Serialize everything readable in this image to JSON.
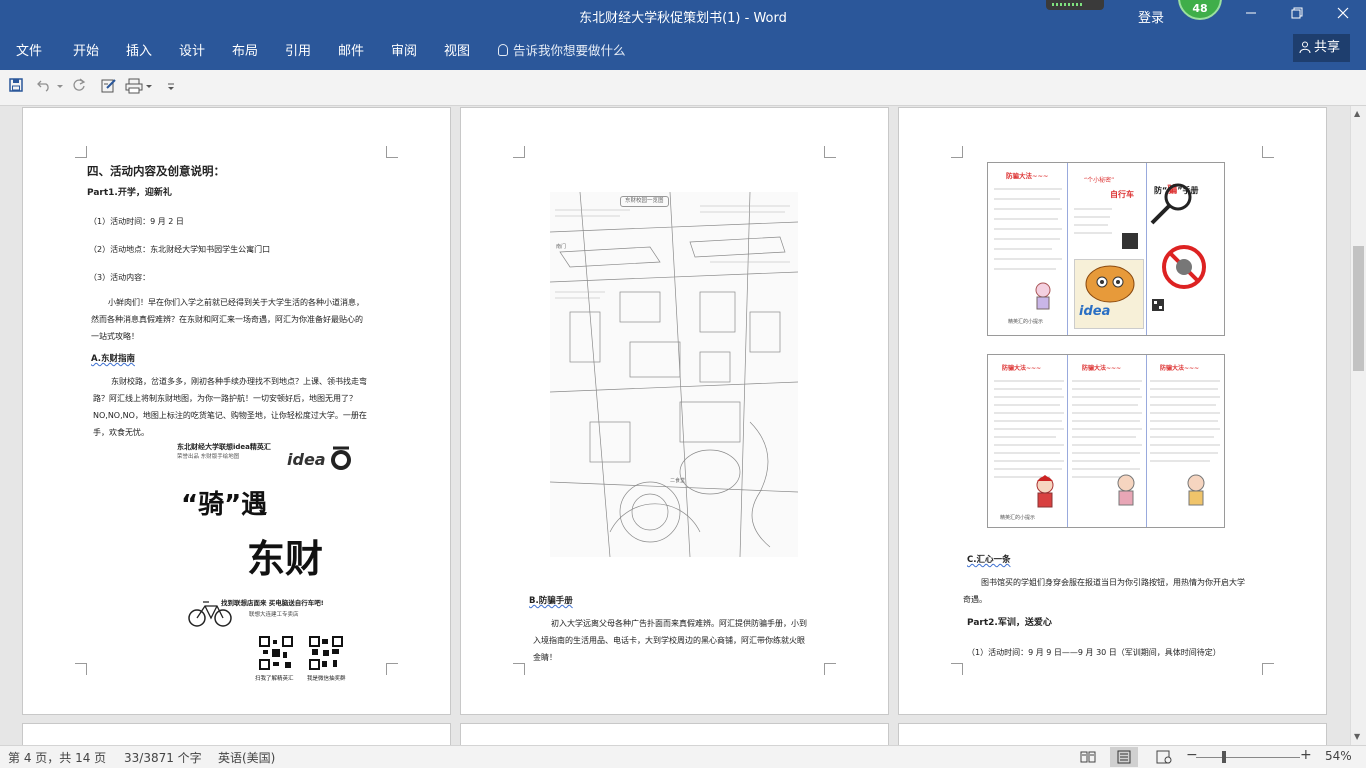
{
  "window": {
    "title": "东北财经大学秋促策划书(1)  -  Word",
    "login_label": "登录",
    "notification_count": "48"
  },
  "ribbon": {
    "tabs": [
      "文件",
      "开始",
      "插入",
      "设计",
      "布局",
      "引用",
      "邮件",
      "审阅",
      "视图"
    ],
    "tell_me_placeholder": "告诉我你想要做什么",
    "share_label": "共享"
  },
  "page1": {
    "heading": "四、活动内容及创意说明：",
    "part1": "Part1.开学，迎新礼",
    "item1": "（1）活动时间：9 月 2 日",
    "item2": "（2）活动地点：东北财经大学知书园学生公寓门口",
    "item3": "（3）活动内容：",
    "para1_l1": "小鲜肉们！早在你们入学之前就已经得到关于大学生活的各种小道消息，",
    "para1_l2": "然而各种消息真假难辨？在东财和阿汇来一场奇遇，阿汇为你准备好最贴心的",
    "para1_l3": "一站式攻略！",
    "sectionA": "A.东财指南",
    "para2_l1": "东财校路，岔道多多，刚初各种手续办理找不到地点？上课、领书找走弯",
    "para2_l2": "路？阿汇线上将制东财地图，为你一路护航！一切安顿好后，地图无用了？",
    "para2_l3": "NO,NO,NO，地图上标注的吃货笔记、购物圣地，让你轻松度过大学。一册在",
    "para2_l4": "手，欢食无忧。",
    "poster_top": "东北财经大学联想idea精英汇",
    "poster_sub": "荣誉出品 东财版手绘地图",
    "poster_brand": "idea",
    "poster_ride": "“骑”遇",
    "poster_campus": "东财",
    "poster_bike": "找到联想店面来 买电脑送自行车吧!",
    "poster_store": "联想大连建工专卖店",
    "qr_left": "扫我了解精英汇",
    "qr_right": "我是微信抽奖群"
  },
  "page2": {
    "map_title": "东财校园一览图",
    "map_label_left": "南门",
    "map_label_bottom": "二食堂",
    "sectionB": "B.防骗手册",
    "para_l1": "初入大学远离父母各种广告扑面而来真假难辨。阿汇提供防骗手册，小到",
    "para_l2": "入境指南的生活用品、电话卡，大到学校周边的黑心商铺，阿汇带你练就火眼",
    "para_l3": "金睛！"
  },
  "page3": {
    "brochure1_left_title": "防骗大法~~~",
    "brochure1_mid_title": "“个小秘密”",
    "brochure1_mid_bike": "自行车",
    "brochure1_right_title_a": "防“",
    "brochure1_right_title_b": "骗",
    "brochure1_right_title_c": "”手册",
    "brochure1_brand": "idea",
    "brochure1_footer": "精英汇的小提示",
    "brochure2_title_left": "防骗大法~~~",
    "brochure2_title_mid": "防骗大法~~~",
    "brochure2_title_right": "防骗大法~~~",
    "brochure2_footer": "精英汇的小提示",
    "sectionC": "C.汇心一条",
    "para_l1": "图书馆买的学姐们身穿会服在报道当日为你引路按钮，用热情为你开启大学",
    "para_l2": "奇遇。",
    "part2": "Part2.军训，送爱心",
    "item1": "（1）活动时间：9 月 9 日——9 月 30 日（军训期间，具体时间待定）"
  },
  "status": {
    "page": "第 4 页，共 14 页",
    "words": "33/3871 个字",
    "language": "英语(美国)",
    "zoom": "54%"
  },
  "colors": {
    "accent": "#2b579a",
    "share_bg": "#1e3e6e",
    "badge": "#3fae49"
  }
}
